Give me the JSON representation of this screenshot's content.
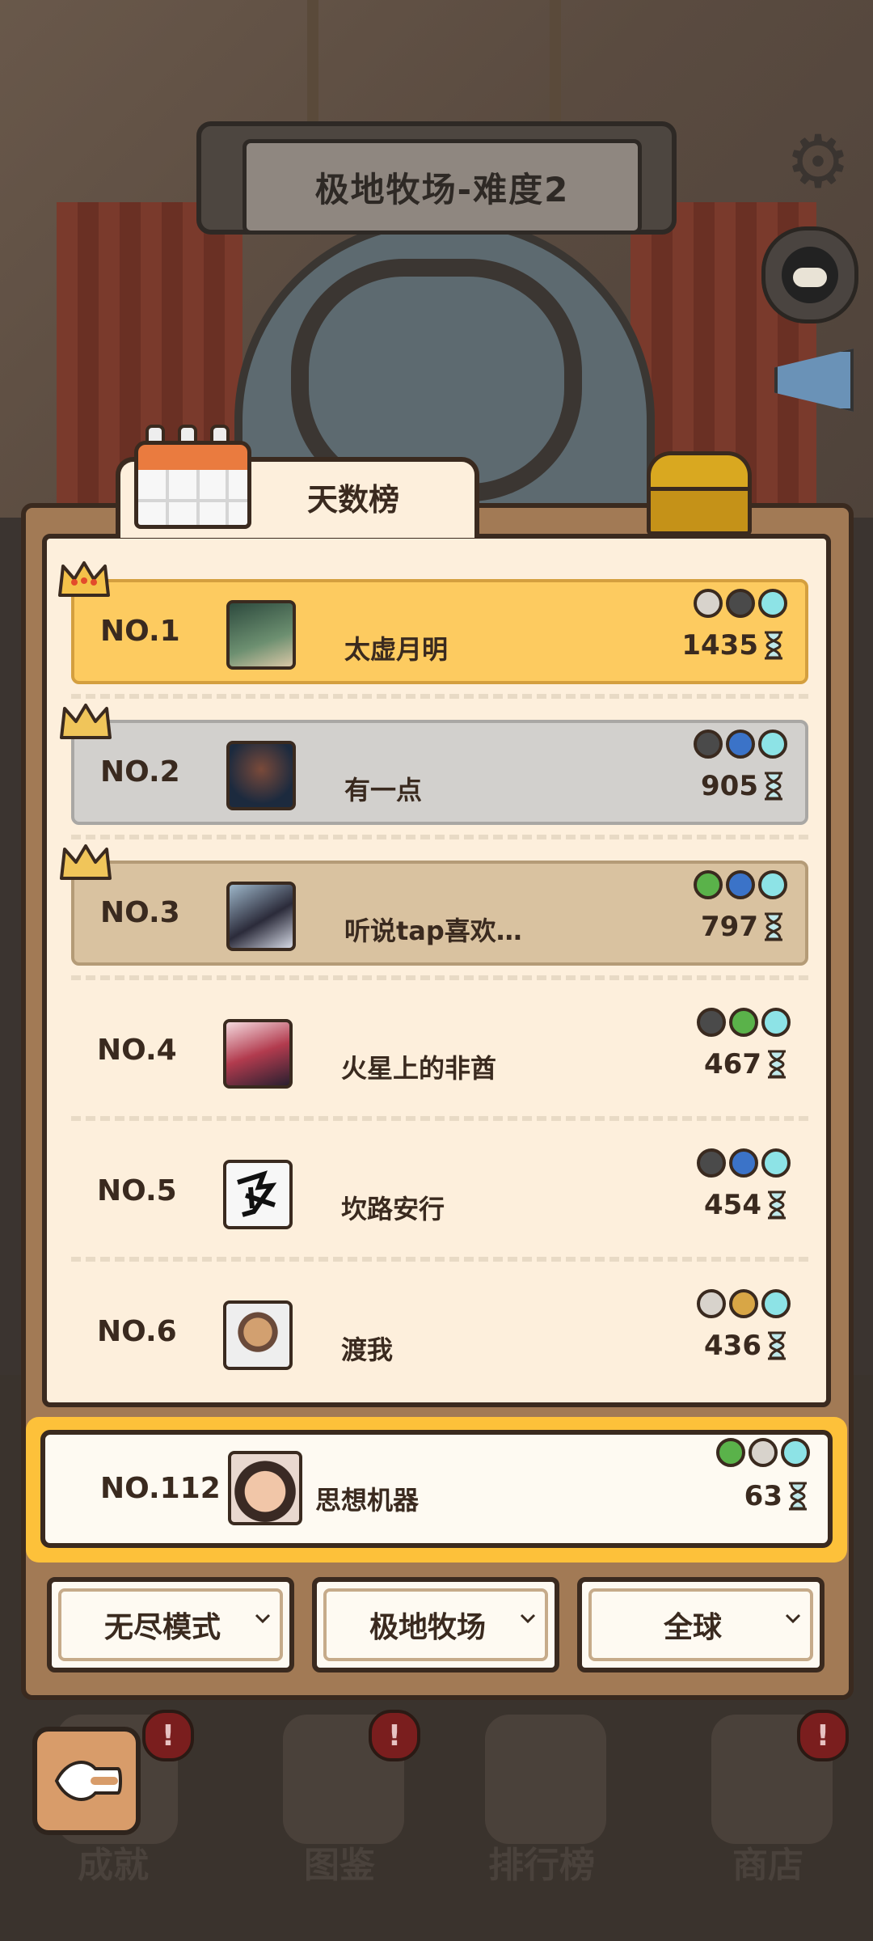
{
  "header": {
    "title": "极地牧场-难度2"
  },
  "panel": {
    "tab_label": "天数榜"
  },
  "leaderboard": [
    {
      "rank": "NO.1",
      "name": "太虚月明",
      "score": "1435",
      "balls": [
        "white",
        "dark",
        "cyan"
      ]
    },
    {
      "rank": "NO.2",
      "name": "有一点",
      "score": "905",
      "balls": [
        "dark",
        "blue",
        "cyan"
      ]
    },
    {
      "rank": "NO.3",
      "name": "听说tap喜欢…",
      "score": "797",
      "balls": [
        "green",
        "blue",
        "cyan"
      ]
    },
    {
      "rank": "NO.4",
      "name": "火星上的非酋",
      "score": "467",
      "balls": [
        "dark",
        "green",
        "cyan"
      ]
    },
    {
      "rank": "NO.5",
      "name": "坎路安行",
      "score": "454",
      "balls": [
        "dark",
        "blue",
        "cyan"
      ]
    },
    {
      "rank": "NO.6",
      "name": "渡我",
      "score": "436",
      "balls": [
        "white",
        "gold",
        "cyan"
      ]
    }
  ],
  "my_rank": {
    "rank": "NO.112",
    "name": "思想机器",
    "score": "63",
    "balls": [
      "green",
      "white",
      "cyan"
    ]
  },
  "filters": [
    {
      "label": "无尽模式"
    },
    {
      "label": "极地牧场"
    },
    {
      "label": "全球"
    }
  ],
  "bottom_nav": [
    {
      "label": "成就",
      "alert": "!"
    },
    {
      "label": "图鉴",
      "alert": "!"
    },
    {
      "label": "排行榜",
      "alert": ""
    },
    {
      "label": "商店",
      "alert": "!"
    }
  ],
  "colors": {
    "gold_row": "#fdcb60",
    "silver_row": "#d2d0cd",
    "bronze_row": "#d9c2a0",
    "panel_bg": "#fdefdc",
    "panel_border": "#a27a55",
    "my_rank_highlight": "#fdc13a"
  },
  "icons": {
    "settings": "gear-icon",
    "qq": "qq-icon",
    "announce": "megaphone-icon",
    "calendar": "calendar-icon",
    "chest": "treasure-chest-icon",
    "back": "back-icon"
  }
}
